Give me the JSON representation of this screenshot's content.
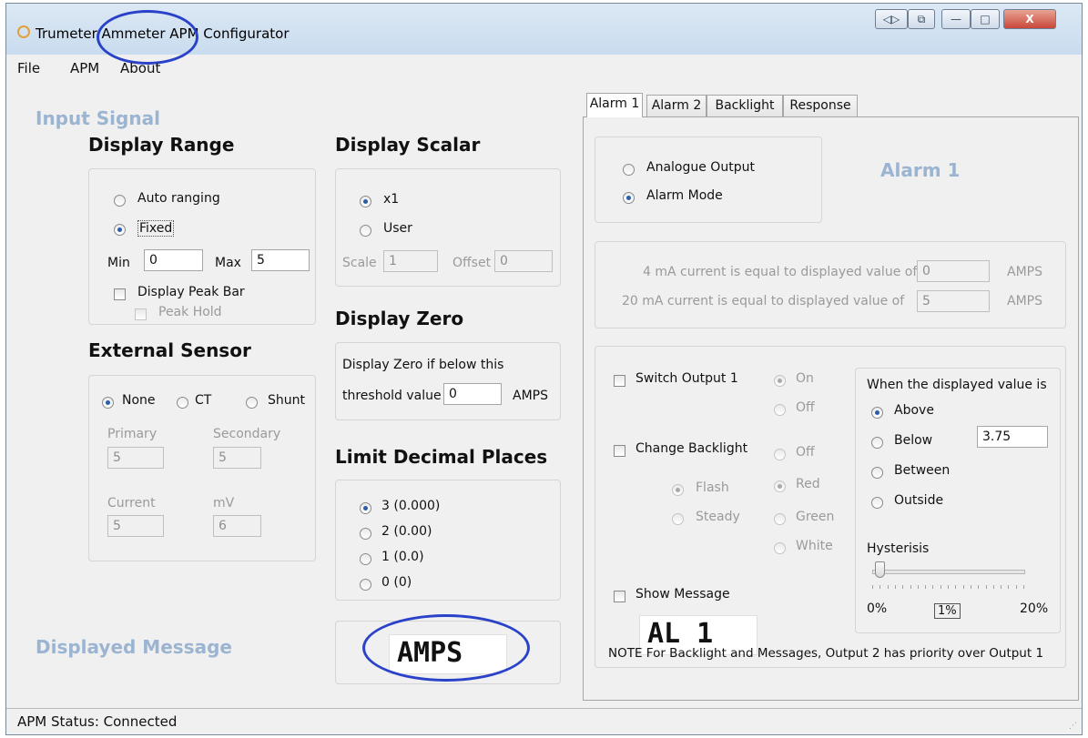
{
  "window": {
    "title": "Trumeter Ammeter APM Configurator",
    "titlebar_buttons": [
      "◁▷",
      "⧉",
      "—",
      "□",
      "X"
    ]
  },
  "menu": [
    "File",
    "APM",
    "About"
  ],
  "input_signal": {
    "heading": "Input Signal",
    "display_range": {
      "heading": "Display Range",
      "auto_ranging": "Auto ranging",
      "fixed": "Fixed",
      "min_label": "Min",
      "min_value": "0",
      "max_label": "Max",
      "max_value": "5",
      "display_peak_bar": "Display Peak Bar",
      "peak_hold": "Peak Hold"
    },
    "external_sensor": {
      "heading": "External Sensor",
      "none": "None",
      "ct": "CT",
      "shunt": "Shunt",
      "primary_label": "Primary",
      "primary_value": "5",
      "secondary_label": "Secondary",
      "secondary_value": "5",
      "current_label": "Current",
      "current_value": "5",
      "mv_label": "mV",
      "mv_value": "6"
    },
    "display_scalar": {
      "heading": "Display Scalar",
      "x1": "x1",
      "user": "User",
      "scale_label": "Scale",
      "scale_value": "1",
      "offset_label": "Offset",
      "offset_value": "0"
    },
    "display_zero": {
      "heading": "Display Zero",
      "line1": "Display Zero if below this",
      "line2": "threshold value",
      "value": "0",
      "unit": "AMPS"
    },
    "limit_decimal": {
      "heading": "Limit Decimal Places",
      "options": [
        "3 (0.000)",
        "2 (0.00)",
        "1 (0.0)",
        "0 (0)"
      ]
    }
  },
  "displayed_message": {
    "heading": "Displayed Message",
    "value": "AMPS"
  },
  "tabs": [
    "Alarm 1",
    "Alarm 2",
    "Backlight",
    "Response"
  ],
  "alarm1": {
    "heading": "Alarm 1",
    "analogue_output": "Analogue Output",
    "alarm_mode": "Alarm Mode",
    "ma4_text": "4 mA current is equal to displayed value of",
    "ma4_value": "0",
    "ma20_text": "20 mA current is equal to displayed value of",
    "ma20_value": "5",
    "amps": "AMPS",
    "switch_output": "Switch Output 1",
    "on": "On",
    "off": "Off",
    "change_backlight": "Change Backlight",
    "backlight_off": "Off",
    "flash": "Flash",
    "red": "Red",
    "steady": "Steady",
    "green": "Green",
    "white": "White",
    "show_message": "Show Message",
    "message_value": "AL 1",
    "when_label": "When the displayed value is",
    "above": "Above",
    "below": "Below",
    "below_value": "3.75",
    "between": "Between",
    "outside": "Outside",
    "hysterisis": "Hysterisis",
    "hyst_min": "0%",
    "hyst_value": "1%",
    "hyst_max": "20%",
    "hyst_level_percent": 1,
    "note": "NOTE  For Backlight and Messages, Output 2 has priority over Output 1"
  },
  "status": "APM Status:  Connected"
}
